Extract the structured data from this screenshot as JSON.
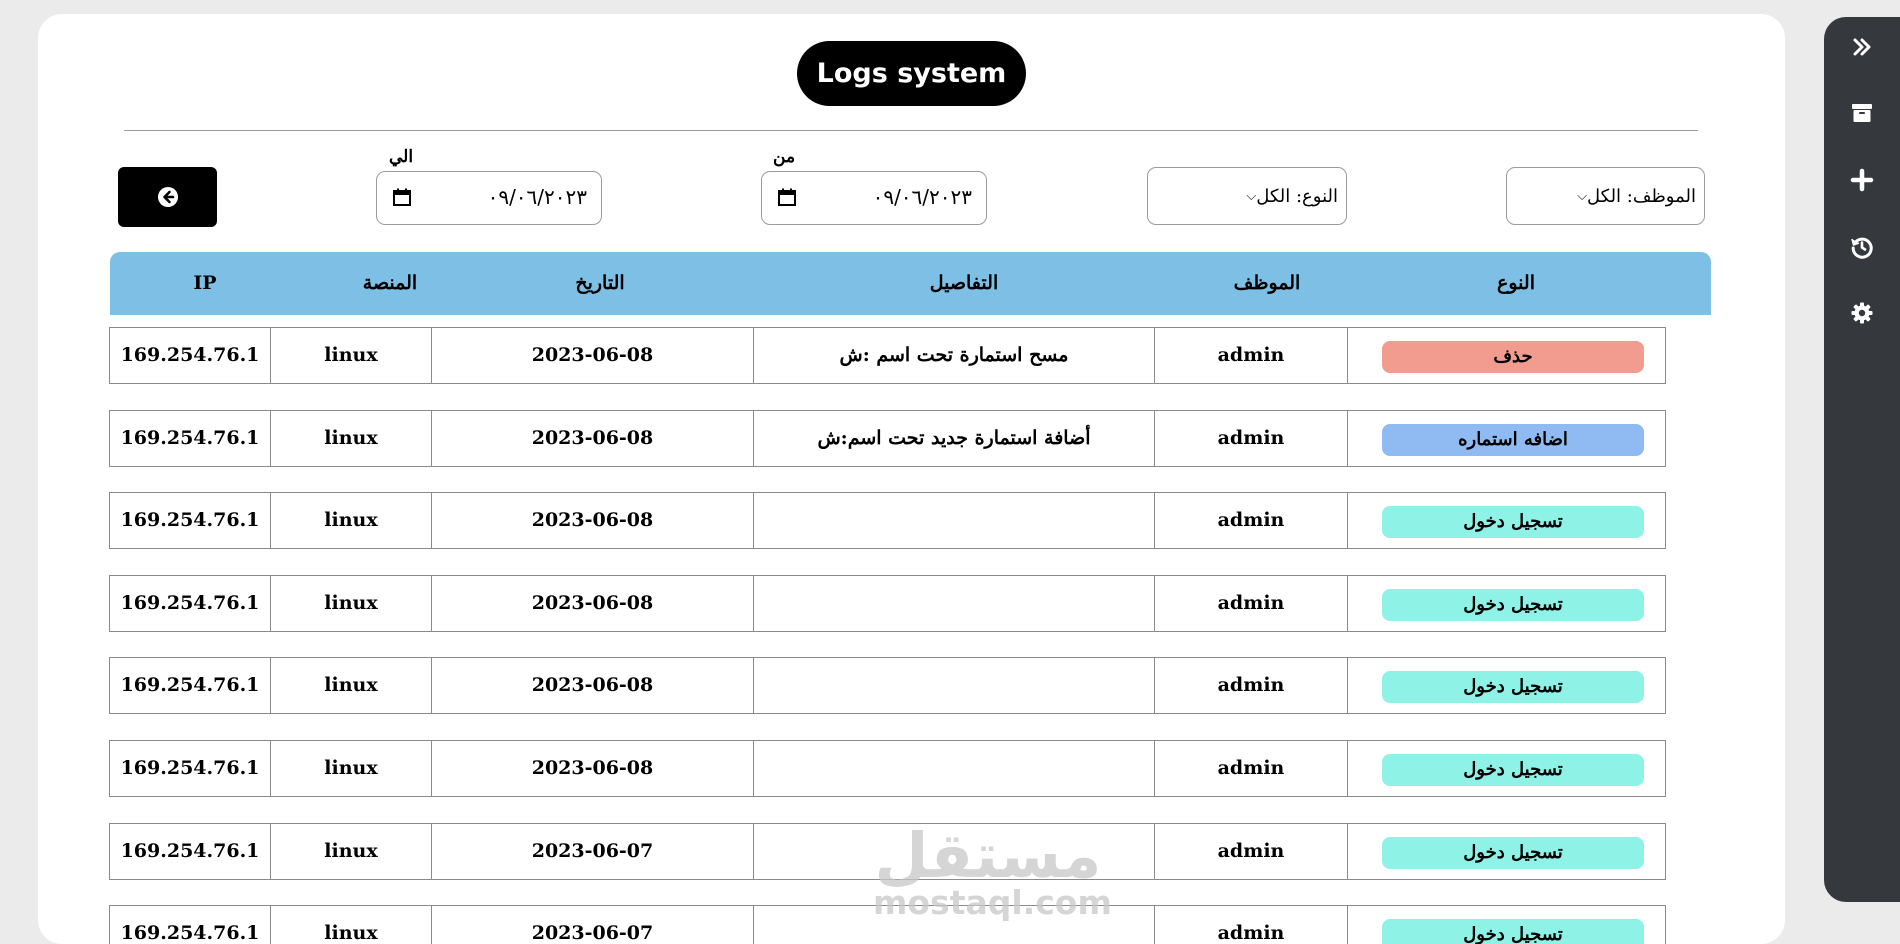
{
  "title": "Logs system",
  "filters": {
    "employee_select": "الموظف: الكل",
    "type_select": "النوع: الكل",
    "from_label": "من",
    "from_value": "٠٩/٠٦/٢٠٢٣",
    "to_label": "الي",
    "to_value": "٠٩/٠٦/٢٠٢٣"
  },
  "table": {
    "headers": {
      "type": "النوع",
      "employee": "الموظف",
      "details": "التفاصيل",
      "date": "التاريخ",
      "platform": "المنصة",
      "ip": "IP"
    },
    "rows": [
      {
        "type": "حذف",
        "type_color": "#f29b8f",
        "employee": "admin",
        "details": "مسح استمارة تحت اسم :ش",
        "date": "2023-06-08",
        "platform": "linux",
        "ip": "169.254.76.1"
      },
      {
        "type": "اضافه استماره",
        "type_color": "#8fbaf2",
        "employee": "admin",
        "details": "أضافة استمارة جديد تحت اسم:ش",
        "date": "2023-06-08",
        "platform": "linux",
        "ip": "169.254.76.1"
      },
      {
        "type": "تسجيل دخول",
        "type_color": "#8ff2e6",
        "employee": "admin",
        "details": "",
        "date": "2023-06-08",
        "platform": "linux",
        "ip": "169.254.76.1"
      },
      {
        "type": "تسجيل دخول",
        "type_color": "#8ff2e6",
        "employee": "admin",
        "details": "",
        "date": "2023-06-08",
        "platform": "linux",
        "ip": "169.254.76.1"
      },
      {
        "type": "تسجيل دخول",
        "type_color": "#8ff2e6",
        "employee": "admin",
        "details": "",
        "date": "2023-06-08",
        "platform": "linux",
        "ip": "169.254.76.1"
      },
      {
        "type": "تسجيل دخول",
        "type_color": "#8ff2e6",
        "employee": "admin",
        "details": "",
        "date": "2023-06-08",
        "platform": "linux",
        "ip": "169.254.76.1"
      },
      {
        "type": "تسجيل دخول",
        "type_color": "#8ff2e6",
        "employee": "admin",
        "details": "",
        "date": "2023-06-07",
        "platform": "linux",
        "ip": "169.254.76.1"
      },
      {
        "type": "تسجيل دخول",
        "type_color": "#8ff2e6",
        "employee": "admin",
        "details": "",
        "date": "2023-06-07",
        "platform": "linux",
        "ip": "169.254.76.1"
      }
    ]
  },
  "sidebar": {
    "icons": [
      "double-chevron-right-icon",
      "archive-icon",
      "plus-icon",
      "history-icon",
      "gear-icon"
    ]
  },
  "watermark": {
    "arabic": "مستقل",
    "latin": "mostaql.com"
  },
  "colors": {
    "header_bg": "#7ebfe6",
    "sidebar_bg": "#35383d",
    "delete_badge": "#f29b8f",
    "add_badge": "#8fbaf2",
    "login_badge": "#8ff2e6"
  }
}
